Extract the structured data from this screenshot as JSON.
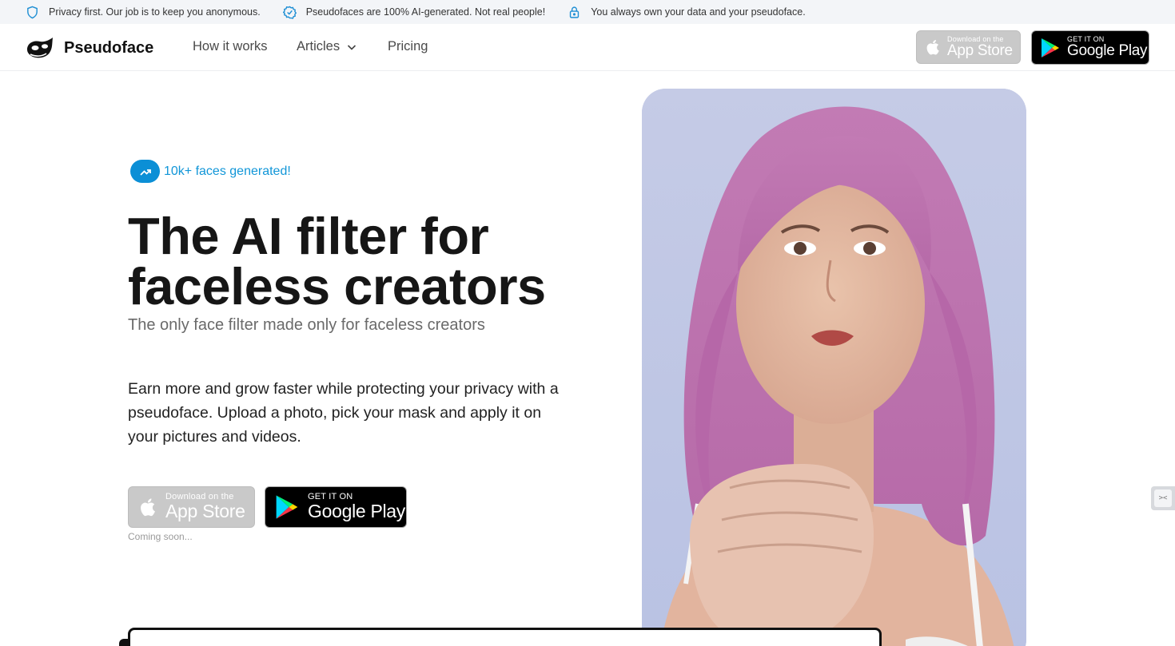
{
  "topbar": {
    "items": [
      {
        "icon": "shield-icon",
        "text": "Privacy first. Our job is to keep you anonymous."
      },
      {
        "icon": "verified-badge-icon",
        "text": "Pseudofaces are 100% AI-generated. Not real people!"
      },
      {
        "icon": "lock-icon",
        "text": "You always own your data and your pseudoface."
      }
    ]
  },
  "nav": {
    "brand": "Pseudoface",
    "links": [
      "How it works",
      "Articles",
      "Pricing"
    ]
  },
  "badges": {
    "apple_small": "Download on the",
    "apple_big": "App Store",
    "google_small": "GET IT ON",
    "google_big": "Google Play"
  },
  "hero": {
    "pill": "10k+ faces generated!",
    "title_line1": "The AI filter for",
    "title_line2": "faceless creators",
    "subtitle": "The only face filter made only for faceless creators",
    "lead": "Earn more and grow faster while protecting your privacy with a pseudoface. Upload a photo, pick your mask and apply it on your pictures and videos.",
    "coming": "Coming soon..."
  },
  "colors": {
    "accent": "#0b8fd6",
    "topbar_bg": "#f3f5f8",
    "text": "#161616"
  }
}
